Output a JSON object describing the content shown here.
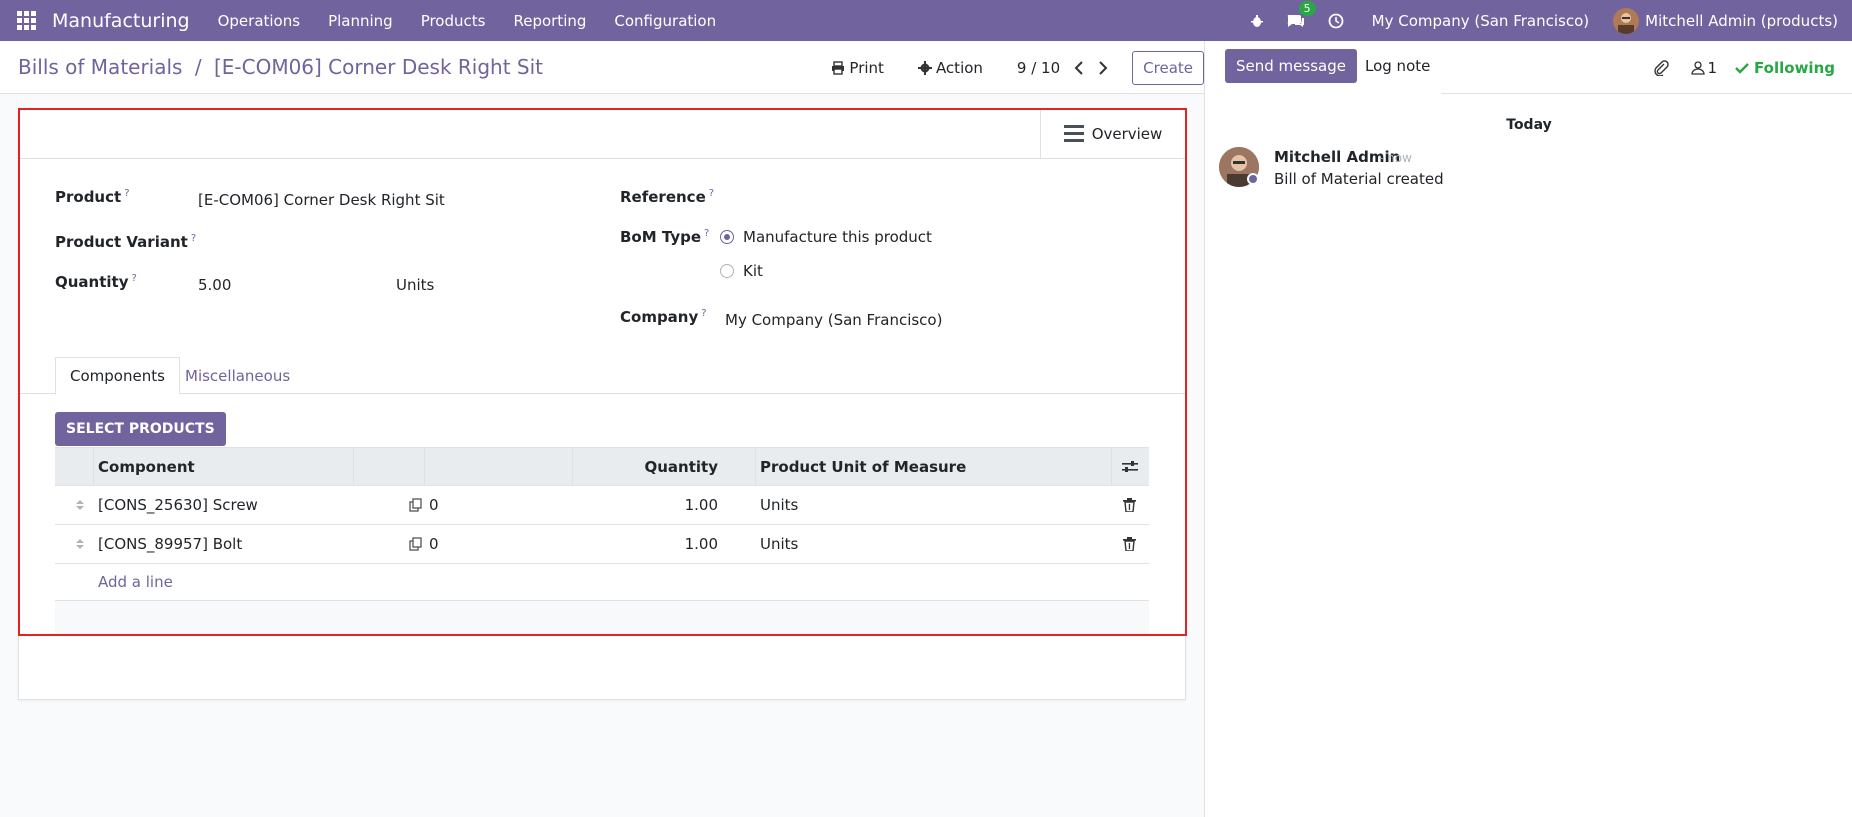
{
  "navbar": {
    "app_name": "Manufacturing",
    "menu": [
      "Operations",
      "Planning",
      "Products",
      "Reporting",
      "Configuration"
    ],
    "messages_badge": "5",
    "company": "My Company (San Francisco)",
    "user": "Mitchell Admin (products)"
  },
  "control_panel": {
    "breadcrumb_parent": "Bills of Materials",
    "breadcrumb_sep": "/",
    "breadcrumb_current": "[E-COM06] Corner Desk Right Sit",
    "print_label": "Print",
    "action_label": "Action",
    "pager": "9 / 10",
    "create_label": "Create"
  },
  "form": {
    "overview_label": "Overview",
    "product_label": "Product",
    "product_value": "[E-COM06] Corner Desk Right Sit",
    "variant_label": "Product Variant",
    "quantity_label": "Quantity",
    "quantity_value": "5.00",
    "quantity_uom": "Units",
    "reference_label": "Reference",
    "bom_type_label": "BoM Type",
    "bom_type_options": [
      "Manufacture this product",
      "Kit"
    ],
    "company_label": "Company",
    "company_value": "My Company (San Francisco)",
    "help_mark": "?"
  },
  "tabs": [
    "Components",
    "Miscellaneous"
  ],
  "components": {
    "select_products_label": "SELECT PRODUCTS",
    "headers": {
      "component": "Component",
      "quantity": "Quantity",
      "uom": "Product Unit of Measure"
    },
    "rows": [
      {
        "component": "[CONS_25630] Screw",
        "col3": "0",
        "quantity": "1.00",
        "uom": "Units"
      },
      {
        "component": "[CONS_89957] Bolt",
        "col3": "0",
        "quantity": "1.00",
        "uom": "Units"
      }
    ],
    "add_line_label": "Add a line"
  },
  "chatter": {
    "send_message_label": "Send message",
    "log_note_label": "Log note",
    "followers_count": "1",
    "following_label": "Following",
    "date_separator": "Today",
    "message": {
      "author": "Mitchell Admin",
      "time": "- now",
      "body": "Bill of Material created"
    }
  },
  "colors": {
    "brand": "#71639e",
    "highlight": "#e02424",
    "following": "#28a745"
  }
}
